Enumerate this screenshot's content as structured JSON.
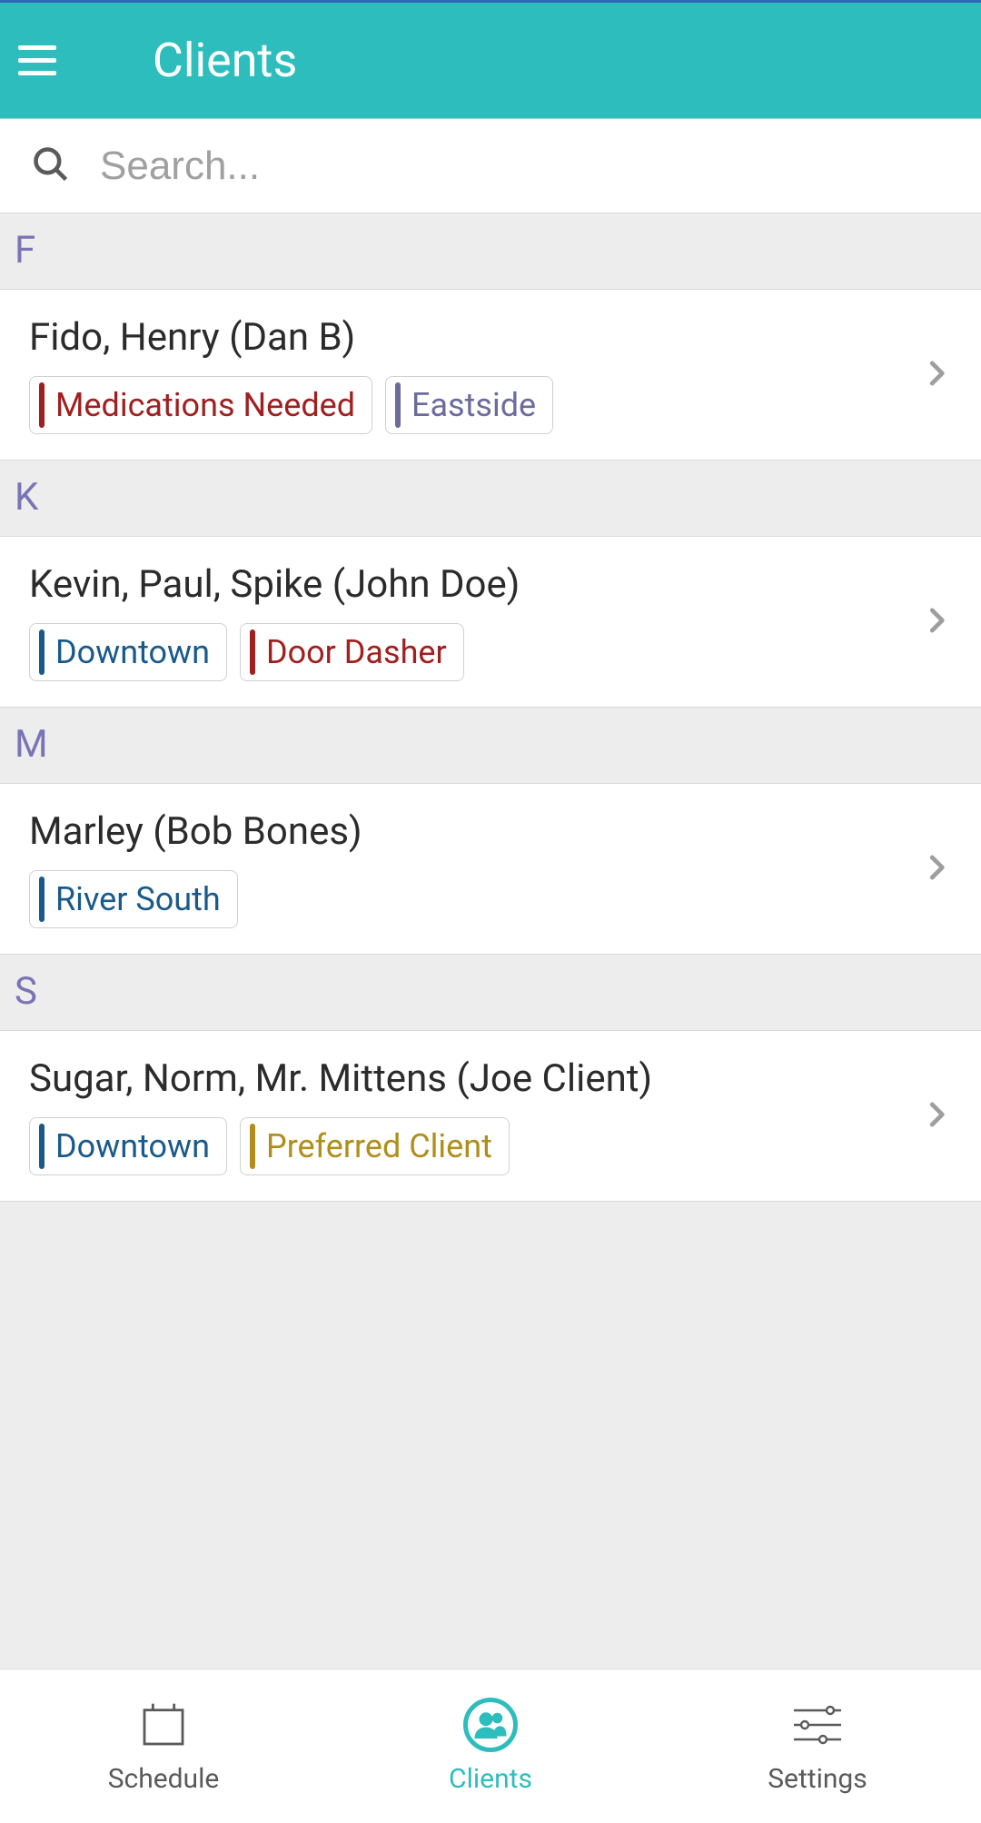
{
  "header": {
    "title": "Clients"
  },
  "search": {
    "placeholder": "Search..."
  },
  "colors": {
    "red": "#a01f1f",
    "purple": "#6b6b9e",
    "blue": "#1a5a8a",
    "gold": "#b08e1a",
    "section_label": "#7a73b5"
  },
  "sections": [
    {
      "letter": "F",
      "items": [
        {
          "name": "Fido, Henry (Dan B)",
          "tags": [
            {
              "label": "Medications Needed",
              "color": "#a01f1f"
            },
            {
              "label": "Eastside",
              "color": "#6b6b9e"
            }
          ]
        }
      ]
    },
    {
      "letter": "K",
      "items": [
        {
          "name": "Kevin, Paul, Spike (John Doe)",
          "tags": [
            {
              "label": "Downtown",
              "color": "#1a5a8a"
            },
            {
              "label": "Door Dasher",
              "color": "#a01f1f"
            }
          ]
        }
      ]
    },
    {
      "letter": "M",
      "items": [
        {
          "name": "Marley (Bob Bones)",
          "tags": [
            {
              "label": "River South",
              "color": "#1a5a8a"
            }
          ]
        }
      ]
    },
    {
      "letter": "S",
      "items": [
        {
          "name": "Sugar, Norm, Mr. Mittens (Joe Client)",
          "tags": [
            {
              "label": "Downtown",
              "color": "#1a5a8a"
            },
            {
              "label": "Preferred Client",
              "color": "#b08e1a"
            }
          ]
        }
      ]
    }
  ],
  "nav": {
    "schedule": "Schedule",
    "clients": "Clients",
    "settings": "Settings",
    "active": "clients"
  }
}
